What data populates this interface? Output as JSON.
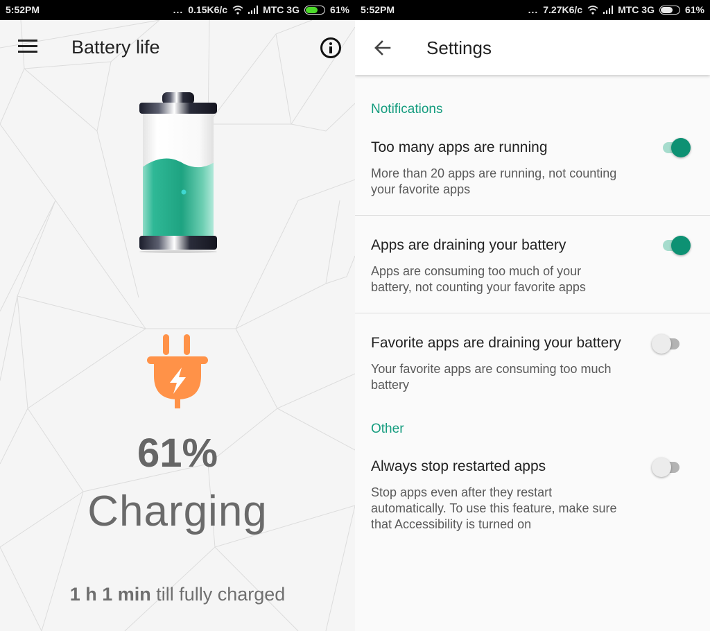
{
  "left_screen": {
    "status_bar": {
      "time": "5:52PM",
      "dots": "...",
      "net_speed": "0.15K6/c",
      "carrier": "MTC 3G",
      "battery_percent": "61%",
      "battery_level": 0.61,
      "battery_fill_color": "#4cdb2a"
    },
    "toolbar": {
      "menu_icon": "hamburger-menu-icon",
      "title": "Battery life",
      "info_icon": "info-icon"
    },
    "battery": {
      "level": 0.61,
      "liquid_color": "#2fb896"
    },
    "plug_icon": {
      "name": "charging-plug-icon",
      "color": "#ff9248"
    },
    "percent": "61%",
    "status": "Charging",
    "eta_bold": "1 h 1 min",
    "eta_rest": " till fully charged"
  },
  "right_screen": {
    "status_bar": {
      "time": "5:52PM",
      "dots": "...",
      "net_speed": "7.27K6/c",
      "carrier": "MTC 3G",
      "battery_percent": "61%",
      "battery_level": 0.61,
      "battery_fill_color": "#e8e8e8"
    },
    "toolbar": {
      "back_icon": "back-arrow-icon",
      "title": "Settings"
    },
    "accent_color": "#149c7e",
    "sections": [
      {
        "header": "Notifications",
        "items": [
          {
            "title": "Too many apps are running",
            "description": "More than 20 apps are running, not counting your favorite apps",
            "enabled": true
          },
          {
            "title": "Apps are draining your battery",
            "description": "Apps are consuming too much of your battery, not counting your favorite apps",
            "enabled": true
          },
          {
            "title": "Favorite apps are draining your battery",
            "description": "Your favorite apps are consuming too much battery",
            "enabled": false
          }
        ]
      },
      {
        "header": "Other",
        "items": [
          {
            "title": "Always stop restarted apps",
            "description": "Stop apps even after they restart automatically. To use this feature, make sure that Accessibility is turned on",
            "enabled": false
          }
        ]
      }
    ]
  }
}
